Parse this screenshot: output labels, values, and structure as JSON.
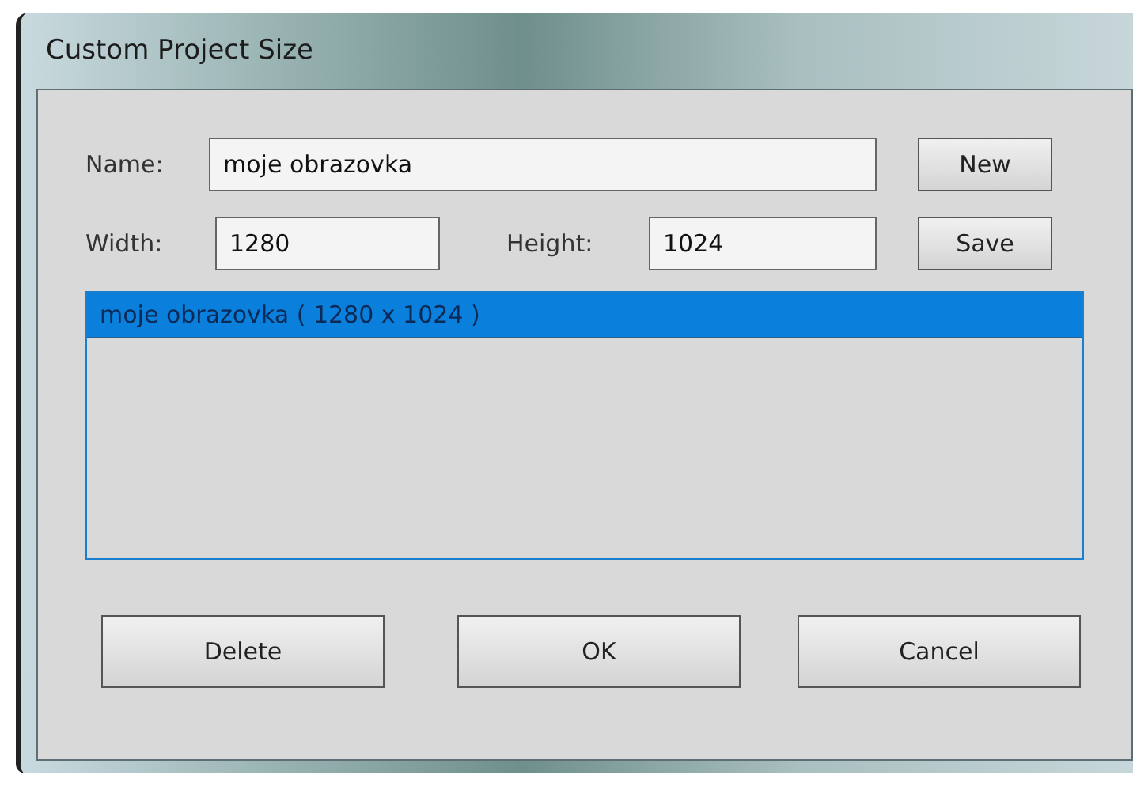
{
  "window": {
    "title": "Custom Project Size"
  },
  "name_field": {
    "label": "Name:",
    "value": "moje obrazovka"
  },
  "width_field": {
    "label": "Width:",
    "value": "1280"
  },
  "height_field": {
    "label": "Height:",
    "value": "1024"
  },
  "side_buttons": [
    "New",
    "Save"
  ],
  "list": {
    "items": [
      {
        "label": "moje obrazovka ( 1280 x 1024 )",
        "selected": true
      }
    ]
  },
  "buttons": [
    "Delete",
    "OK",
    "Cancel"
  ]
}
